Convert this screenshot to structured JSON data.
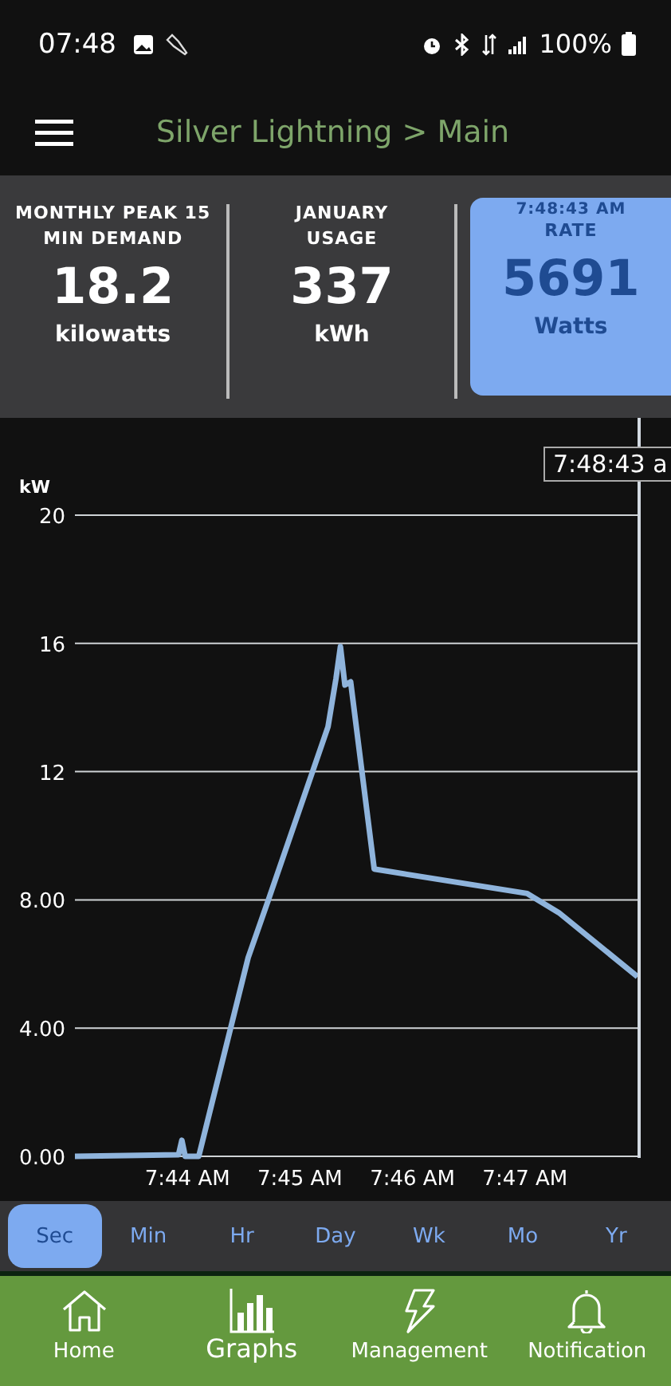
{
  "status_bar": {
    "time": "07:48",
    "battery": "100%"
  },
  "app_bar": {
    "title": "Silver Lightning > Main"
  },
  "stats": [
    {
      "label": "MONTHLY PEAK 15 MIN DEMAND",
      "value": "18.2",
      "unit": "kilowatts",
      "selected": false
    },
    {
      "label": "JANUARY USAGE",
      "value": "337",
      "unit": "kWh",
      "selected": false
    },
    {
      "time": "7:48:43 AM",
      "label": "RATE",
      "value": "5691",
      "unit": "Watts",
      "selected": true
    }
  ],
  "chart": {
    "cursor_label": "7:48:43 a",
    "chart_data": {
      "type": "line",
      "ylabel": "kW",
      "x": [
        463.0,
        463.92,
        463.95,
        463.98,
        464.1,
        464.54,
        464.72,
        465.25,
        465.32,
        465.36,
        465.4,
        465.45,
        465.66,
        467.02,
        467.3,
        468.0
      ],
      "series": [
        {
          "color": "#8fb4dc",
          "values": [
            0,
            0.05,
            0.5,
            0,
            0,
            6.2,
            8,
            13.4,
            14.9,
            15.9,
            14.7,
            14.8,
            8.96,
            8.2,
            7.6,
            5.6
          ]
        }
      ],
      "grid": true,
      "xlim": [
        463,
        468
      ],
      "ylim": [
        0,
        20
      ],
      "xticks": [
        {
          "value": 464,
          "label": "7:44 AM"
        },
        {
          "value": 465,
          "label": "7:45 AM"
        },
        {
          "value": 466,
          "label": "7:46 AM"
        },
        {
          "value": 467,
          "label": "7:47 AM"
        }
      ],
      "yticks": [
        {
          "value": 0,
          "label": "0.00"
        },
        {
          "value": 4,
          "label": "4.00"
        },
        {
          "value": 8,
          "label": "8.00"
        },
        {
          "value": 12,
          "label": "12"
        },
        {
          "value": 16,
          "label": "16"
        },
        {
          "value": 20,
          "label": "20"
        }
      ]
    }
  },
  "ranges": [
    {
      "label": "Sec",
      "selected": true
    },
    {
      "label": "Min",
      "selected": false
    },
    {
      "label": "Hr",
      "selected": false
    },
    {
      "label": "Day",
      "selected": false
    },
    {
      "label": "Wk",
      "selected": false
    },
    {
      "label": "Mo",
      "selected": false
    },
    {
      "label": "Yr",
      "selected": false
    }
  ],
  "nav": [
    {
      "kind": "home",
      "label": "Home",
      "selected": false
    },
    {
      "kind": "graphs",
      "label": "Graphs",
      "selected": true
    },
    {
      "kind": "management",
      "label": "Management",
      "selected": false
    },
    {
      "kind": "notifications",
      "label": "Notification",
      "selected": false
    }
  ]
}
